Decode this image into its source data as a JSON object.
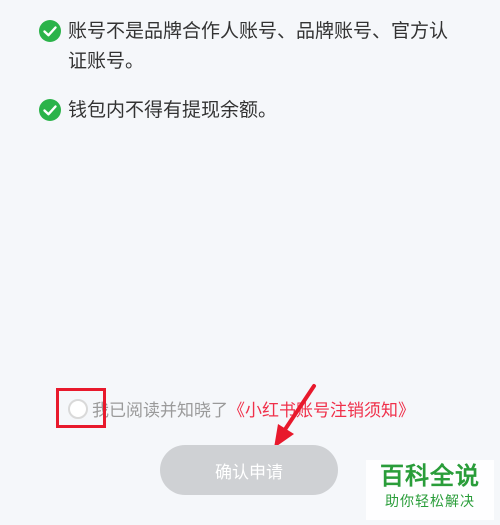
{
  "conditions": [
    "账号不是品牌合作人账号、品牌账号、官方认证账号。",
    "钱包内不得有提现余额。"
  ],
  "agreement": {
    "text": "我已阅读并知晓了",
    "link": "《小红书账号注销须知》",
    "checked": false
  },
  "confirm_button": "确认申请",
  "watermark": {
    "title": "百科全说",
    "subtitle": "助你轻松解决"
  },
  "colors": {
    "check": "#2bb34a",
    "link": "#f0304a",
    "button_disabled": "#cfd1d4",
    "annotation": "#e8192c",
    "watermark": "#2a9d3a"
  }
}
